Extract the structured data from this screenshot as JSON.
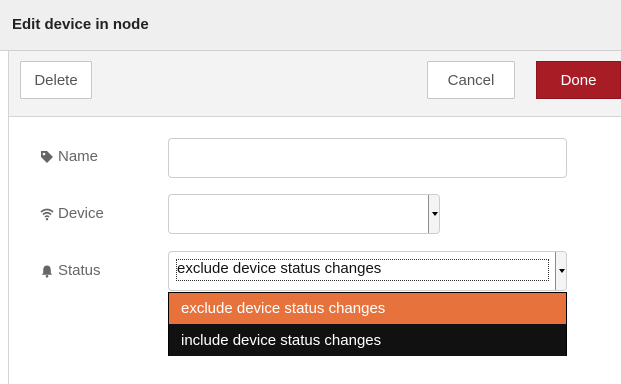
{
  "dialog": {
    "title": "Edit device in node"
  },
  "toolbar": {
    "delete_label": "Delete",
    "cancel_label": "Cancel",
    "done_label": "Done"
  },
  "form": {
    "name": {
      "label": "Name",
      "icon": "tag-icon",
      "value": ""
    },
    "device": {
      "label": "Device",
      "icon": "wifi-icon",
      "value": ""
    },
    "status": {
      "label": "Status",
      "icon": "bell-icon",
      "value": "exclude device status changes",
      "options": [
        "exclude device status changes",
        "include device status changes"
      ],
      "highlighted_option": 0
    }
  },
  "colors": {
    "done_bg": "#a81c25",
    "option_highlight": "#e8723c",
    "dropdown_bg": "#111111"
  }
}
